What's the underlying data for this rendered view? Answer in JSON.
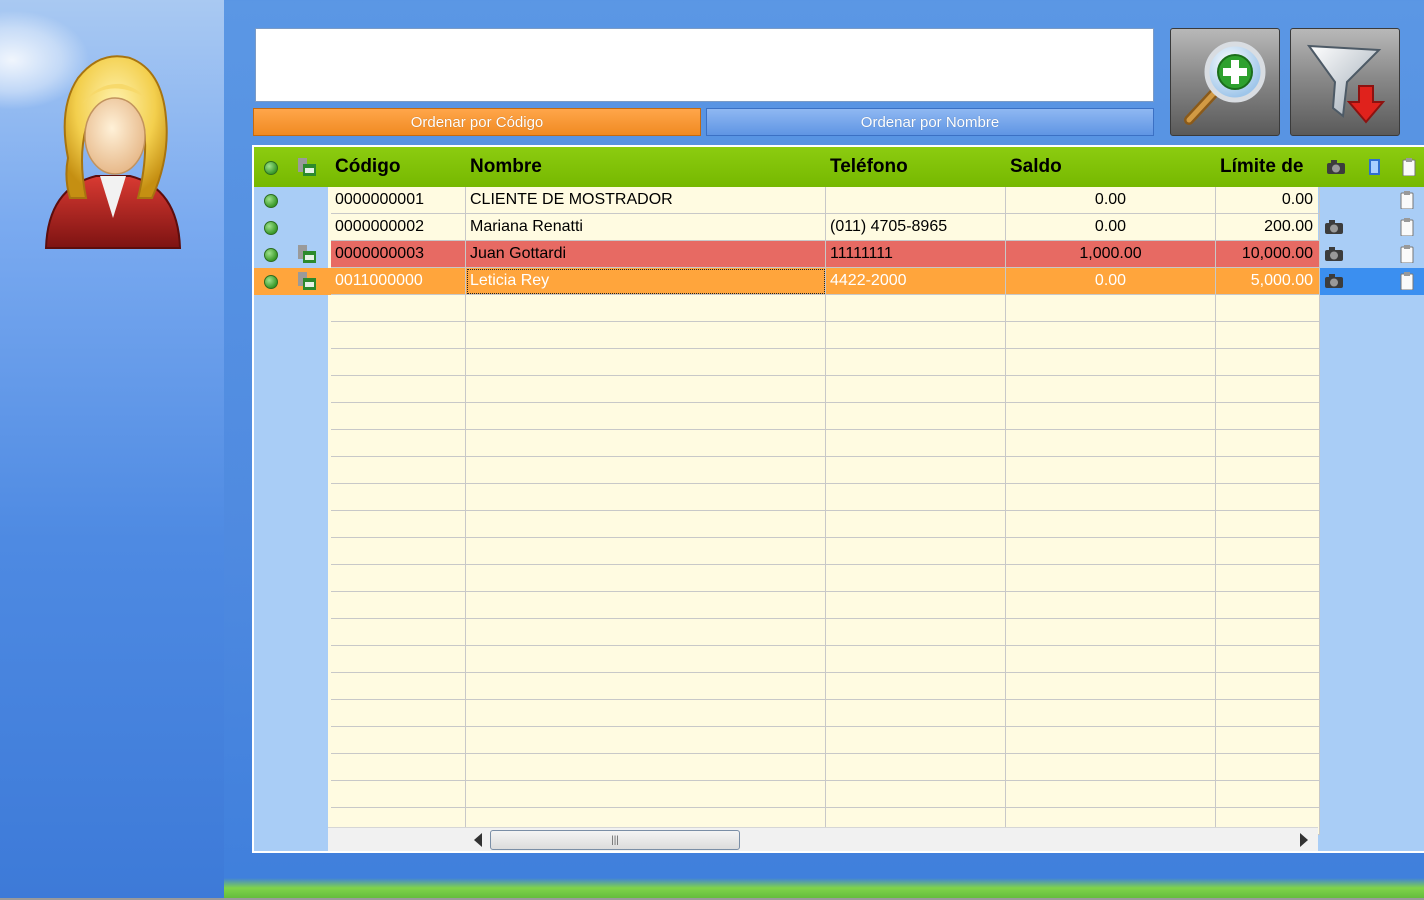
{
  "search": {
    "value": ""
  },
  "sort_buttons": {
    "by_code": "Ordenar por Código",
    "by_name": "Ordenar por Nombre"
  },
  "icons": {
    "avatar": "businesswoman-avatar",
    "add_search": "magnifier-plus-icon",
    "filter": "funnel-arrow-icon",
    "status": "green-dot-icon",
    "account_card": "account-card-icon",
    "camera": "camera-icon",
    "book": "book-icon",
    "clipboard": "clipboard-icon"
  },
  "colors": {
    "header_green": "#80c000",
    "row_red": "#e76a63",
    "row_selected": "#ffa53c",
    "sort_active": "#f59a36",
    "sort_inactive": "#6fa0e8"
  },
  "grid": {
    "columns": {
      "codigo": "Código",
      "nombre": "Nombre",
      "telefono": "Teléfono",
      "saldo": "Saldo",
      "limite": "Límite de"
    },
    "rows": [
      {
        "codigo": "0000000001",
        "nombre": "CLIENTE DE MOSTRADOR",
        "telefono": "",
        "saldo": "0.00",
        "limite": "0.00",
        "card": false,
        "camera": false
      },
      {
        "codigo": "0000000002",
        "nombre": "Mariana Renatti",
        "telefono": "(011) 4705-8965",
        "saldo": "0.00",
        "limite": "200.00",
        "card": false,
        "camera": true
      },
      {
        "codigo": "0000000003",
        "nombre": "Juan Gottardi",
        "telefono": "11111111",
        "saldo": "1,000.00",
        "limite": "10,000.00",
        "card": true,
        "camera": true
      },
      {
        "codigo": "0011000000",
        "nombre": "Leticia Rey",
        "telefono": "4422-2000",
        "saldo": "0.00",
        "limite": "5,000.00",
        "card": true,
        "camera": true
      }
    ]
  }
}
